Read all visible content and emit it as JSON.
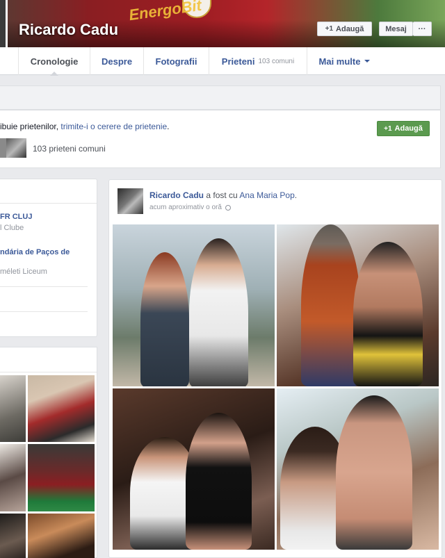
{
  "profile": {
    "name": "Ricardo Cadu",
    "cover_text": "EnergoBit",
    "buttons": {
      "add": "Adaugă",
      "message": "Mesaj",
      "more": "···"
    }
  },
  "nav": {
    "tabs": [
      {
        "label": "Cronologie"
      },
      {
        "label": "Despre"
      },
      {
        "label": "Fotografii"
      },
      {
        "label": "Prieteni",
        "sub": "103 comuni"
      },
      {
        "label": "Mai multe"
      }
    ]
  },
  "friend_request": {
    "text_before": "ribuie prietenilor, ",
    "link": "trimite-i o cerere de prietenie",
    "text_after": ".",
    "add_button": "Adaugă",
    "mutual": "103 prieteni comuni"
  },
  "about": {
    "items": [
      {
        "title": "FR CLUJ",
        "sub": "l Clube"
      },
      {
        "title": "ndária de Paços de",
        "sub": "méleti Liceum"
      }
    ]
  },
  "post": {
    "author": "Ricardo Cadu",
    "with_text": "a fost cu",
    "tagged": "Ana Maria Pop",
    "end": ".",
    "time": "acum aproximativ o oră"
  },
  "colors": {
    "link": "#3b5998",
    "green": "#5b9a4f",
    "bg": "#e9eaed"
  }
}
